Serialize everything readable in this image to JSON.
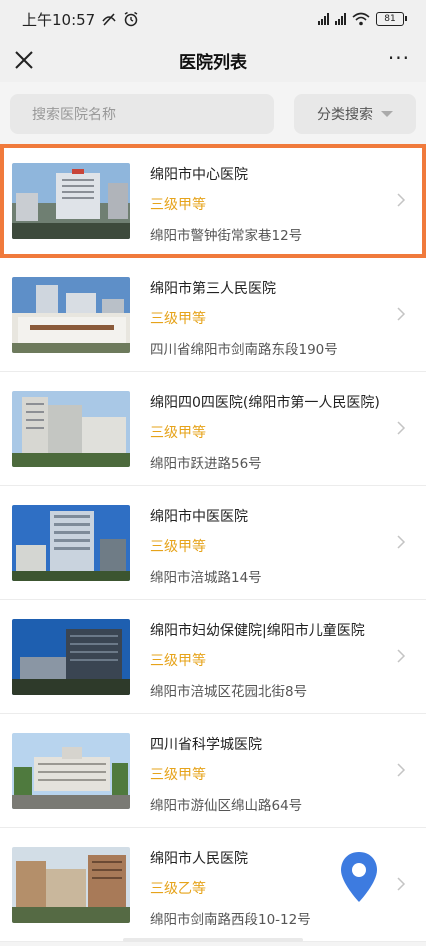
{
  "status_bar": {
    "time": "上午10:57",
    "icons": [
      "mute-icon",
      "alarm-icon",
      "hd-signal-icon",
      "hd-signal-icon",
      "wifi-icon"
    ],
    "battery": "81"
  },
  "nav": {
    "title": "医院列表",
    "close_icon": "close-icon",
    "more_label": "···"
  },
  "search": {
    "placeholder": "搜索医院名称",
    "category_label": "分类搜索"
  },
  "colors": {
    "level": "#e6a31a",
    "highlight": "#f07a3c",
    "pin": "#3d7be0"
  },
  "hospitals": [
    {
      "name": "绵阳市中心医院",
      "level": "三级甲等",
      "address": "绵阳市警钟街常家巷12号",
      "selected": true
    },
    {
      "name": "绵阳市第三人民医院",
      "level": "三级甲等",
      "address": "四川省绵阳市剑南路东段190号",
      "selected": false
    },
    {
      "name": "绵阳四0四医院(绵阳市第一人民医院)",
      "level": "三级甲等",
      "address": "绵阳市跃进路56号",
      "selected": false
    },
    {
      "name": "绵阳市中医医院",
      "level": "三级甲等",
      "address": "绵阳市涪城路14号",
      "selected": false
    },
    {
      "name": "绵阳市妇幼保健院|绵阳市儿童医院",
      "level": "三级甲等",
      "address": "绵阳市涪城区花园北街8号",
      "selected": false
    },
    {
      "name": "四川省科学城医院",
      "level": "三级甲等",
      "address": "绵阳市游仙区绵山路64号",
      "selected": false
    },
    {
      "name": "绵阳市人民医院",
      "level": "三级乙等",
      "address": "绵阳市剑南路西段10-12号",
      "selected": false
    }
  ]
}
